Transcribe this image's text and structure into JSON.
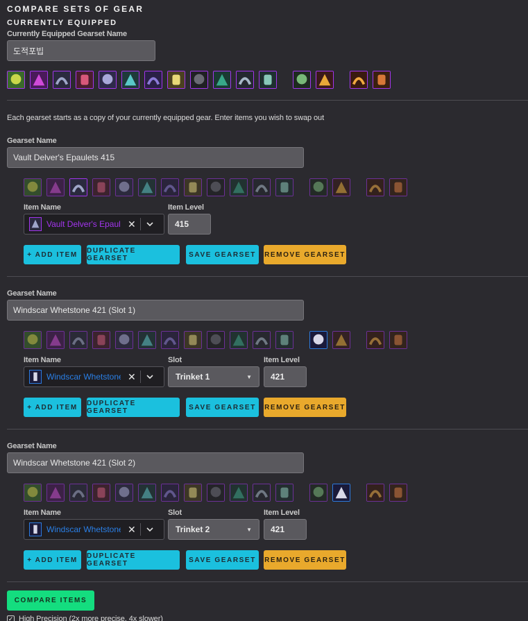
{
  "page": {
    "title": "COMPARE SETS OF GEAR",
    "subtitle": "CURRENTLY EQUIPPED",
    "equipped_label": "Currently Equipped Gearset Name",
    "equipped_name": "도적포빕",
    "intro": "Each gearset starts as a copy of your currently equipped gear. Enter items you wish to swap out"
  },
  "equipped_icons": [
    {
      "name": "head-icon",
      "c1": "#3a6a2a",
      "c2": "#c9d84a"
    },
    {
      "name": "neck-icon",
      "c1": "#4a1a5a",
      "c2": "#d04ad8"
    },
    {
      "name": "shoulder-icon",
      "c1": "#2a2a3e",
      "c2": "#9ea6c8"
    },
    {
      "name": "back-icon",
      "c1": "#4a1e2e",
      "c2": "#d8587a"
    },
    {
      "name": "chest-icon",
      "c1": "#2e2a4a",
      "c2": "#a8a8d8"
    },
    {
      "name": "wrist-icon",
      "c1": "#1e3a3a",
      "c2": "#5ac8c8"
    },
    {
      "name": "hands-icon",
      "c1": "#2a2046",
      "c2": "#8c7ad8"
    },
    {
      "name": "waist-icon",
      "c1": "#4a4020",
      "c2": "#e8d878"
    },
    {
      "name": "legs-icon",
      "c1": "#202024",
      "c2": "#6a6a74"
    },
    {
      "name": "feet-icon",
      "c1": "#1a3a32",
      "c2": "#38a888"
    },
    {
      "name": "ring1-icon",
      "c1": "#242830",
      "c2": "#a8b8c8"
    },
    {
      "name": "ring2-icon",
      "c1": "#1e3030",
      "c2": "#88c8b8"
    },
    {
      "name": "trinket1-icon",
      "c1": "#1e2a20",
      "c2": "#78b878"
    },
    {
      "name": "trinket2-icon",
      "c1": "#3a1a1a",
      "c2": "#e8a838"
    },
    {
      "name": "mainhand-icon",
      "c1": "#3a1a10",
      "c2": "#f0a840"
    },
    {
      "name": "offhand-icon",
      "c1": "#3a2010",
      "c2": "#d87838"
    }
  ],
  "gearsets": [
    {
      "name_label": "Gearset Name",
      "name": "Vault Delver's Epaulets 415",
      "item_label": "Item Name",
      "item_name": "Vault Delver's Epaulets",
      "item_quality": "epic",
      "level_label": "Item Level",
      "level": "415",
      "swap_index": 2,
      "buttons": {
        "add": "+ ADD ITEM",
        "dup": "DUPLICATE GEARSET",
        "save": "SAVE GEARSET",
        "remove": "REMOVE GEARSET"
      }
    },
    {
      "name_label": "Gearset Name",
      "name": "Windscar Whetstone 421 (Slot 1)",
      "item_label": "Item Name",
      "item_name": "Windscar Whetstone",
      "item_quality": "rare",
      "slot_label": "Slot",
      "slot": "Trinket 1",
      "level_label": "Item Level",
      "level": "421",
      "swap_index": 12,
      "buttons": {
        "add": "+ ADD ITEM",
        "dup": "DUPLICATE GEARSET",
        "save": "SAVE GEARSET",
        "remove": "REMOVE GEARSET"
      }
    },
    {
      "name_label": "Gearset Name",
      "name": "Windscar Whetstone 421 (Slot 2)",
      "item_label": "Item Name",
      "item_name": "Windscar Whetstone",
      "item_quality": "rare",
      "slot_label": "Slot",
      "slot": "Trinket 2",
      "level_label": "Item Level",
      "level": "421",
      "swap_index": 13,
      "buttons": {
        "add": "+ ADD ITEM",
        "dup": "DUPLICATE GEARSET",
        "save": "SAVE GEARSET",
        "remove": "REMOVE GEARSET"
      }
    }
  ],
  "footer": {
    "compare": "COMPARE ITEMS",
    "checkbox_label": "High Precision (2x more precise, 4x slower)",
    "checkbox_checked": true
  }
}
